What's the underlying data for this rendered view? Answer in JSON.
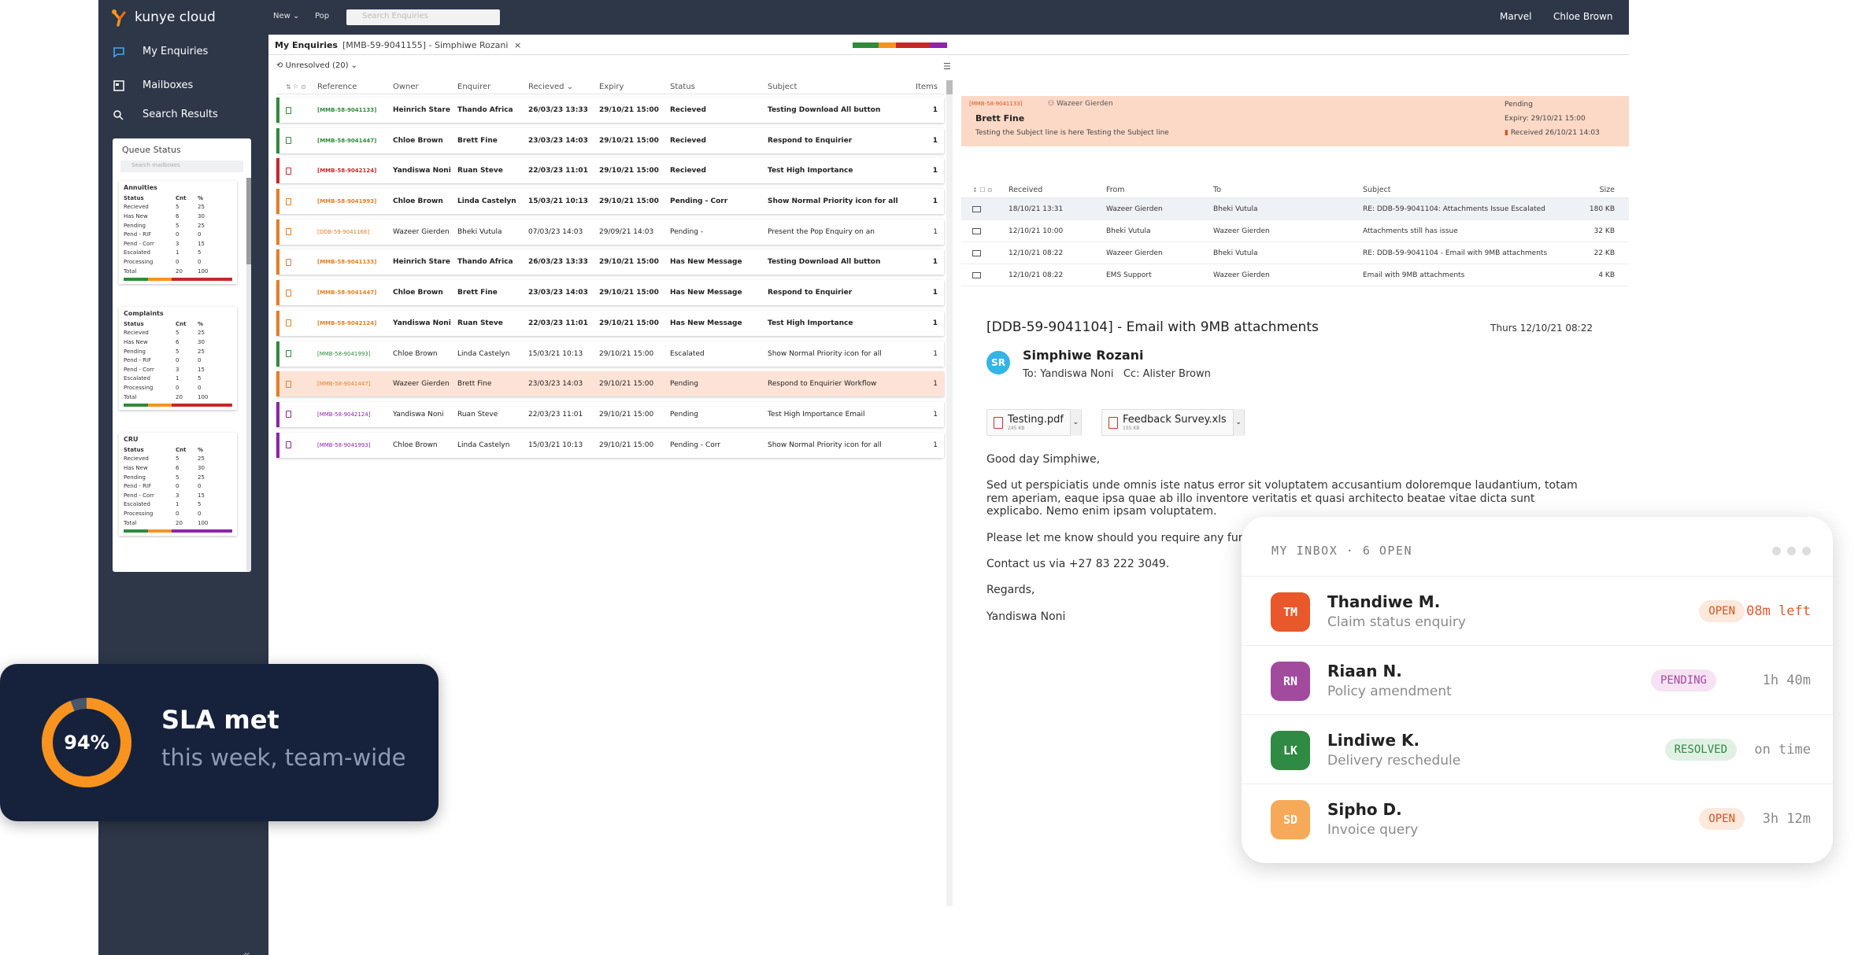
{
  "topbar": {
    "logo": "kunye cloud",
    "new": "New",
    "pop": "Pop",
    "search_placeholder": "Search Enquiries",
    "org": "Marvel",
    "user": "Chloe Brown"
  },
  "nav": {
    "my_enquiries": "My Enquiries",
    "mailboxes": "Mailboxes",
    "search_results": "Search Results"
  },
  "queue": {
    "title": "Queue Status",
    "search_placeholder": "Search mailboxes",
    "headers": [
      "Status",
      "Cnt",
      "%"
    ],
    "cards": [
      {
        "name": "Annuities",
        "rows": [
          [
            "Recieved",
            "5",
            "25"
          ],
          [
            "Has New",
            "6",
            "30"
          ],
          [
            "Pending",
            "5",
            "25"
          ],
          [
            "Pend - RIF",
            "0",
            "0"
          ],
          [
            "Pend - Corr",
            "3",
            "15"
          ],
          [
            "Escalated",
            "1",
            "5"
          ],
          [
            "Processing",
            "0",
            "0"
          ],
          [
            "Total",
            "20",
            "100"
          ]
        ]
      },
      {
        "name": "Complaints",
        "rows": [
          [
            "Recieved",
            "5",
            "25"
          ],
          [
            "Has New",
            "6",
            "30"
          ],
          [
            "Pending",
            "5",
            "25"
          ],
          [
            "Pend - RIF",
            "0",
            "0"
          ],
          [
            "Pend - Corr",
            "3",
            "15"
          ],
          [
            "Escalated",
            "1",
            "5"
          ],
          [
            "Processing",
            "0",
            "0"
          ],
          [
            "Total",
            "20",
            "100"
          ]
        ]
      },
      {
        "name": "CRU",
        "rows": [
          [
            "Recieved",
            "5",
            "25"
          ],
          [
            "Has New",
            "6",
            "30"
          ],
          [
            "Pending",
            "5",
            "25"
          ],
          [
            "Pend - RIF",
            "0",
            "0"
          ],
          [
            "Pend - Corr",
            "3",
            "15"
          ],
          [
            "Escalated",
            "1",
            "5"
          ],
          [
            "Processing",
            "0",
            "0"
          ],
          [
            "Total",
            "20",
            "100"
          ]
        ]
      }
    ]
  },
  "tabs": {
    "my_enquiries": "My Enquiries",
    "open_tab": "[MMB-59-9041155] - Simphiwe Rozani",
    "close": "×"
  },
  "filter": {
    "label": "Unresolved (20)"
  },
  "grid": {
    "headers": {
      "reference": "Reference",
      "owner": "Owner",
      "enquirer": "Enquirer",
      "received": "Recieved",
      "expiry": "Expiry",
      "status": "Status",
      "subject": "Subject",
      "items": "Items"
    },
    "rows": [
      {
        "ref": "[MMB-58-9041133]",
        "owner": "Heinrich Stare",
        "enquirer": "Thando Africa",
        "received": "26/03/23 13:33",
        "expiry": "29/10/21 15:00",
        "status": "Recieved",
        "subject": "Testing Download All button",
        "items": "1",
        "color": "#2e8b3a",
        "bold": true,
        "hl": false
      },
      {
        "ref": "[MMB-58-9041447]",
        "owner": "Chloe Brown",
        "enquirer": "Brett Fine",
        "received": "23/03/23 14:03",
        "expiry": "29/10/21 15:00",
        "status": "Recieved",
        "subject": "Respond to Enquirier",
        "items": "1",
        "color": "#2e8b3a",
        "bold": true,
        "hl": false
      },
      {
        "ref": "[MMB-58-9042124]",
        "owner": "Yandiswa Noni",
        "enquirer": "Ruan Steve",
        "received": "22/03/23 11:01",
        "expiry": "29/10/21 15:00",
        "status": "Recieved",
        "subject": "Test High Importance",
        "items": "1",
        "color": "#c62828",
        "bold": true,
        "hl": false
      },
      {
        "ref": "[MMB-58-9041993]",
        "owner": "Chloe Brown",
        "enquirer": "Linda Castelyn",
        "received": "15/03/21 10:13",
        "expiry": "29/10/21 15:00",
        "status": "Pending - Corr",
        "subject": "Show Normal Priority icon for all",
        "items": "1",
        "color": "#e67e22",
        "bold": true,
        "hl": false
      },
      {
        "ref": "[DDB-59-9041166]",
        "owner": "Wazeer Gierden",
        "enquirer": "Bheki Vutula",
        "received": "07/03/23 14:03",
        "expiry": "29/09/21 14:03",
        "status": "Pending -",
        "subject": "Present the Pop Enquiry on an",
        "items": "1",
        "color": "#e67e22",
        "bold": false,
        "hl": false
      },
      {
        "ref": "[MMB-58-9041133]",
        "owner": "Heinrich Stare",
        "enquirer": "Thando Africa",
        "received": "26/03/23 13:33",
        "expiry": "29/10/21 15:00",
        "status": "Has New Message",
        "subject": "Testing Download All button",
        "items": "1",
        "color": "#e67e22",
        "bold": true,
        "hl": false
      },
      {
        "ref": "[MMB-58-9041447]",
        "owner": "Chloe Brown",
        "enquirer": "Brett Fine",
        "received": "23/03/23 14:03",
        "expiry": "29/10/21 15:00",
        "status": "Has New Message",
        "subject": "Respond to Enquirier",
        "items": "1",
        "color": "#e67e22",
        "bold": true,
        "hl": false
      },
      {
        "ref": "[MMB-58-9042124]",
        "owner": "Yandiswa Noni",
        "enquirer": "Ruan Steve",
        "received": "22/03/23 11:01",
        "expiry": "29/10/21 15:00",
        "status": "Has New Message",
        "subject": "Test High Importance",
        "items": "1",
        "color": "#e67e22",
        "bold": true,
        "hl": false
      },
      {
        "ref": "[MMB-58-9041993]",
        "owner": "Chloe Brown",
        "enquirer": "Linda Castelyn",
        "received": "15/03/21 10:13",
        "expiry": "29/10/21 15:00",
        "status": "Escalated",
        "subject": "Show Normal Priority icon for all",
        "items": "1",
        "color": "#2e8b3a",
        "bold": false,
        "hl": false
      },
      {
        "ref": "[MMB-58-9041447]",
        "owner": "Wazeer Gierden",
        "enquirer": "Brett Fine",
        "received": "23/03/23 14:03",
        "expiry": "29/10/21 15:00",
        "status": "Pending",
        "subject": "Respond to Enquirier Workflow",
        "items": "1",
        "color": "#e67e22",
        "bold": false,
        "hl": true
      },
      {
        "ref": "[MMB-58-9042124]",
        "owner": "Yandiswa Noni",
        "enquirer": "Ruan Steve",
        "received": "22/03/23 11:01",
        "expiry": "29/10/21 15:00",
        "status": "Pending",
        "subject": "Test High Importance Email",
        "items": "1",
        "color": "#8e24aa",
        "bold": false,
        "hl": false
      },
      {
        "ref": "[MMB-58-9041993]",
        "owner": "Chloe Brown",
        "enquirer": "Linda Castelyn",
        "received": "15/03/21 10:13",
        "expiry": "29/10/21 15:00",
        "status": "Pending - Corr",
        "subject": "Show Normal Priority icon for all",
        "items": "1",
        "color": "#8e24aa",
        "bold": false,
        "hl": false
      }
    ]
  },
  "detail": {
    "banner": {
      "ref": "[MMB-58-9041133]",
      "assignee": "Wazeer Gierden",
      "name": "Brett Fine",
      "subject_line": "Testing the Subject line is here Testing the Subject line",
      "status": "Pending",
      "expiry": "Expiry: 29/10/21 15:00",
      "received": "Received 26/10/21 14:03"
    },
    "mail_headers": {
      "received": "Received",
      "from": "From",
      "to": "To",
      "subject": "Subject",
      "size": "Size"
    },
    "mails": [
      {
        "received": "18/10/21 13:31",
        "from": "Wazeer Gierden",
        "to": "Bheki Vutula",
        "subject": "RE: DDB-59-9041104: Attachments Issue Escalated",
        "size": "180 KB"
      },
      {
        "received": "12/10/21 10:00",
        "from": "Bheki Vutula",
        "to": "Wazeer Gierden",
        "subject": "Attachments still has issue",
        "size": "32 KB"
      },
      {
        "received": "12/10/21 08:22",
        "from": "Wazeer Gierden",
        "to": "Bheki Vutula",
        "subject": "RE: DDB-59-9041104 - Email with 9MB attachments",
        "size": "22 KB"
      },
      {
        "received": "12/10/21 08:22",
        "from": "EMS Support",
        "to": "Wazeer Gierden",
        "subject": "Email with 9MB attachments",
        "size": "4 KB"
      }
    ],
    "email": {
      "subject": "[DDB-59-9041104] - Email with 9MB attachments",
      "date": "Thurs 12/10/21 08:22",
      "avatar": "SR",
      "sender": "Simphiwe Rozani",
      "to": "To: Yandiswa Noni",
      "cc": "Cc: Alister Brown",
      "attachments": [
        {
          "name": "Testing.pdf",
          "size": "245 KB"
        },
        {
          "name": "Feedback Survey.xls",
          "size": "155 KB"
        }
      ],
      "greeting": "Good day Simphiwe,",
      "para1": "Sed ut perspiciatis unde omnis iste natus error sit voluptatem accusantium doloremque laudantium, totam rem aperiam, eaque ipsa quae ab illo inventore veritatis et quasi architecto beatae vitae dicta sunt explicabo. Nemo enim ipsam voluptatem.",
      "para2": "Please let me know should you require any further assistance.",
      "para3": "Contact us via +27 83 222 3049.",
      "regards": "Regards,",
      "signature": "Yandiswa Noni"
    }
  },
  "sla": {
    "percent": "94%",
    "value": 0.94,
    "title": "SLA met",
    "subtitle": "this week, team-wide",
    "color": "#f7931e"
  },
  "inbox": {
    "title": "MY INBOX · 6 OPEN",
    "items": [
      {
        "initials": "TM",
        "name": "Thandiwe M.",
        "desc": "Claim status enquiry",
        "status": "OPEN",
        "time": "08m left",
        "avatar_color": "#e8582a",
        "pill_bg": "#fde8dc",
        "pill_fg": "#d9541e",
        "time_color": "#e8582a"
      },
      {
        "initials": "RN",
        "name": "Riaan N.",
        "desc": "Policy amendment",
        "status": "PENDING",
        "time": "1h 40m",
        "avatar_color": "#a24a9e",
        "pill_bg": "#f6e2f4",
        "pill_fg": "#a24a9e",
        "time_color": "#888888"
      },
      {
        "initials": "LK",
        "name": "Lindiwe K.",
        "desc": "Delivery reschedule",
        "status": "RESOLVED",
        "time": "on time",
        "avatar_color": "#2f8a43",
        "pill_bg": "#e0f1e4",
        "pill_fg": "#2f8a43",
        "time_color": "#888888"
      },
      {
        "initials": "SD",
        "name": "Sipho D.",
        "desc": "Invoice query",
        "status": "OPEN",
        "time": "3h 12m",
        "avatar_color": "#f7a95a",
        "pill_bg": "#fde8dc",
        "pill_fg": "#d9541e",
        "time_color": "#888888"
      }
    ]
  }
}
